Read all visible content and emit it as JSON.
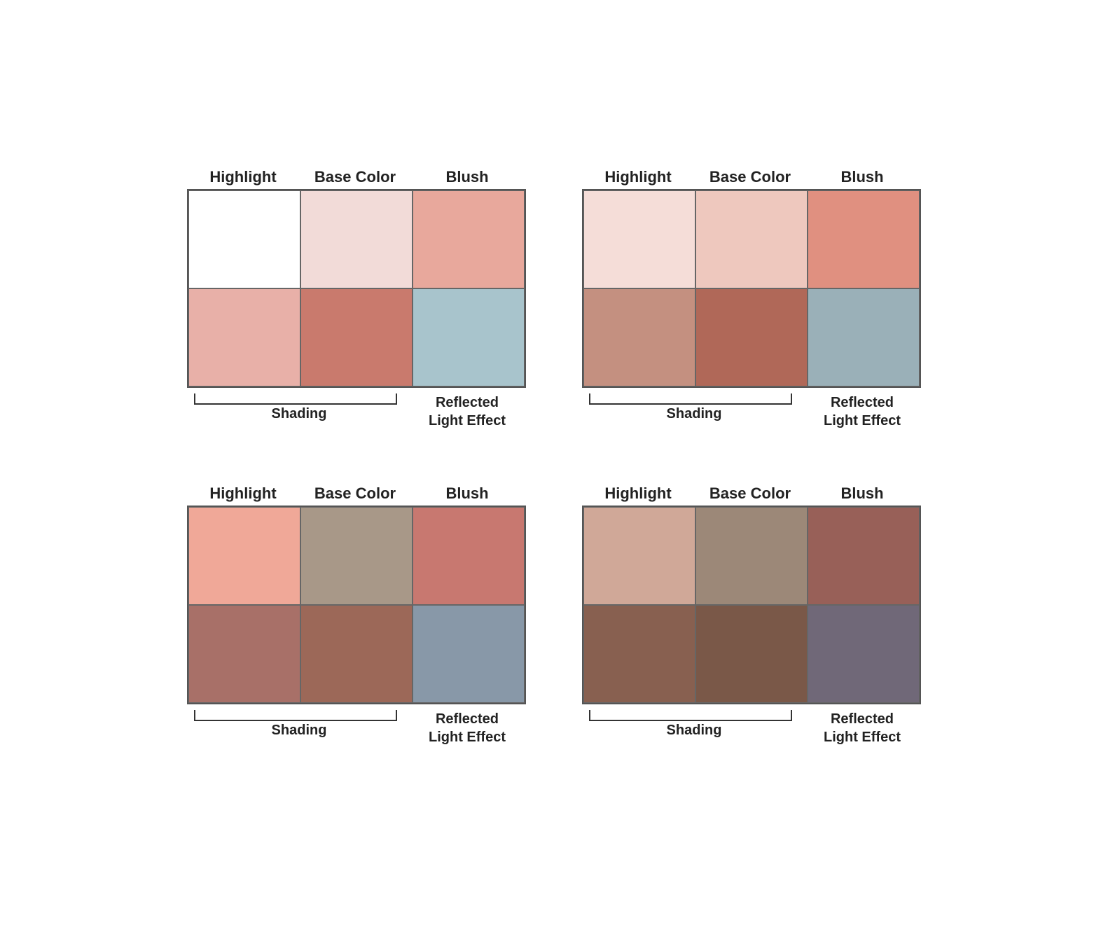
{
  "palettes": [
    {
      "id": "top-left",
      "labels": {
        "highlight": "Highlight",
        "base_color": "Base Color",
        "blush": "Blush",
        "shading": "Shading",
        "reflected": "Reflected\nLight Effect"
      },
      "cells": [
        "#ffffff",
        "#f2dbd8",
        "#e8a89c",
        "#e8b0a8",
        "#c97a6d",
        "#a8c4cc"
      ]
    },
    {
      "id": "top-right",
      "labels": {
        "highlight": "Highlight",
        "base_color": "Base Color",
        "blush": "Blush",
        "shading": "Shading",
        "reflected": "Reflected\nLight Effect"
      },
      "cells": [
        "#f5ddd8",
        "#eec8be",
        "#e09080",
        "#c49080",
        "#b06858",
        "#9ab0b8"
      ]
    },
    {
      "id": "bottom-left",
      "labels": {
        "highlight": "Highlight",
        "base_color": "Base Color",
        "blush": "Blush",
        "shading": "Shading",
        "reflected": "Reflected\nLight Effect"
      },
      "cells": [
        "#f0a898",
        "#a89888",
        "#c87870",
        "#a87068",
        "#9c6858",
        "#8898a8"
      ]
    },
    {
      "id": "bottom-right",
      "labels": {
        "highlight": "Highlight",
        "base_color": "Base Color",
        "blush": "Blush",
        "shading": "Shading",
        "reflected": "Reflected\nLight Effect"
      },
      "cells": [
        "#d0a898",
        "#9c8878",
        "#986058",
        "#886050",
        "#7a5848",
        "#706878"
      ]
    }
  ]
}
